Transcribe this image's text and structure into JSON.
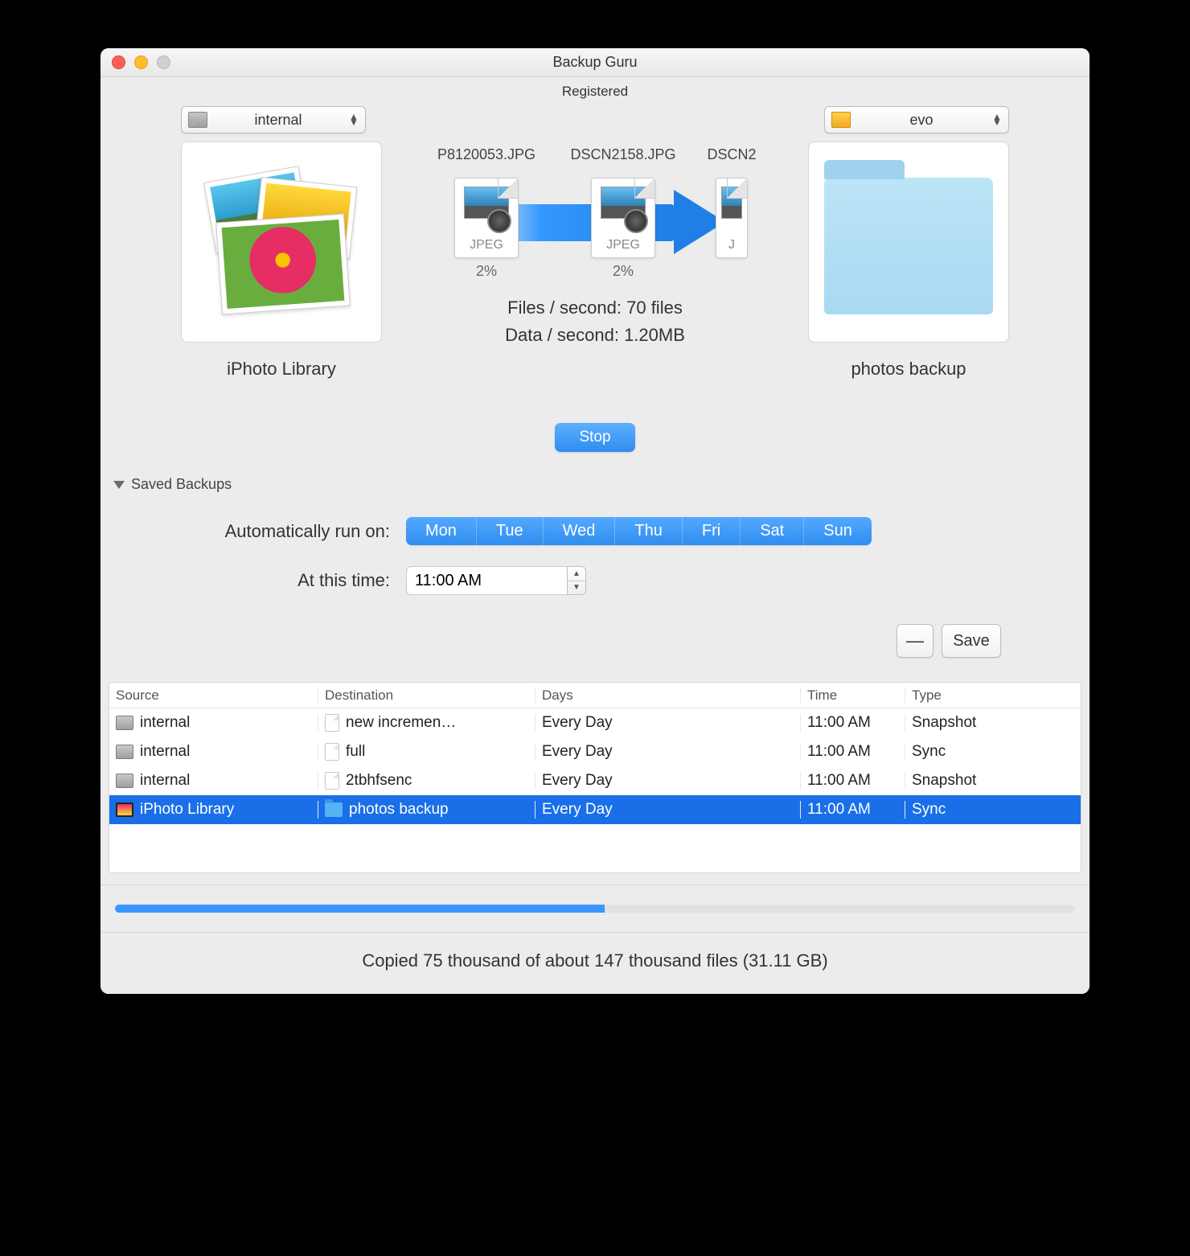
{
  "window": {
    "title": "Backup Guru",
    "registered": "Registered"
  },
  "source_popup": {
    "label": "internal"
  },
  "dest_popup": {
    "label": "evo"
  },
  "source_item": {
    "label": "iPhoto Library"
  },
  "dest_item": {
    "label": "photos backup"
  },
  "transfer_files": [
    {
      "name": "P8120053.JPG",
      "type": "JPEG",
      "pct": "2%"
    },
    {
      "name": "DSCN2158.JPG",
      "type": "JPEG",
      "pct": "2%"
    },
    {
      "name": "DSCN2",
      "type": "J",
      "pct": ""
    }
  ],
  "rates": {
    "files": "Files / second: 70 files",
    "data": "Data / second: 1.20MB"
  },
  "stop": "Stop",
  "disclosure": "Saved Backups",
  "schedule": {
    "run_label": "Automatically run on:",
    "days": [
      "Mon",
      "Tue",
      "Wed",
      "Thu",
      "Fri",
      "Sat",
      "Sun"
    ],
    "time_label": "At this time:",
    "time_value": "11:00 AM"
  },
  "buttons": {
    "remove": "—",
    "save": "Save"
  },
  "table": {
    "headers": {
      "src": "Source",
      "dst": "Destination",
      "days": "Days",
      "time": "Time",
      "type": "Type"
    },
    "rows": [
      {
        "src": "internal",
        "dst": "new incremen…",
        "days": "Every Day",
        "time": "11:00 AM",
        "type": "Snapshot",
        "src_icon": "drive",
        "dst_icon": "page",
        "selected": false
      },
      {
        "src": "internal",
        "dst": "full",
        "days": "Every Day",
        "time": "11:00 AM",
        "type": "Sync",
        "src_icon": "drive",
        "dst_icon": "page",
        "selected": false
      },
      {
        "src": "internal",
        "dst": "2tbhfsenc",
        "days": "Every Day",
        "time": "11:00 AM",
        "type": "Snapshot",
        "src_icon": "drive",
        "dst_icon": "page",
        "selected": false
      },
      {
        "src": "iPhoto Library",
        "dst": "photos backup",
        "days": "Every Day",
        "time": "11:00 AM",
        "type": "Sync",
        "src_icon": "iphoto",
        "dst_icon": "folder",
        "selected": true
      }
    ]
  },
  "progress_pct": 51,
  "status": "Copied 75 thousand of about 147 thousand files (31.11 GB)"
}
